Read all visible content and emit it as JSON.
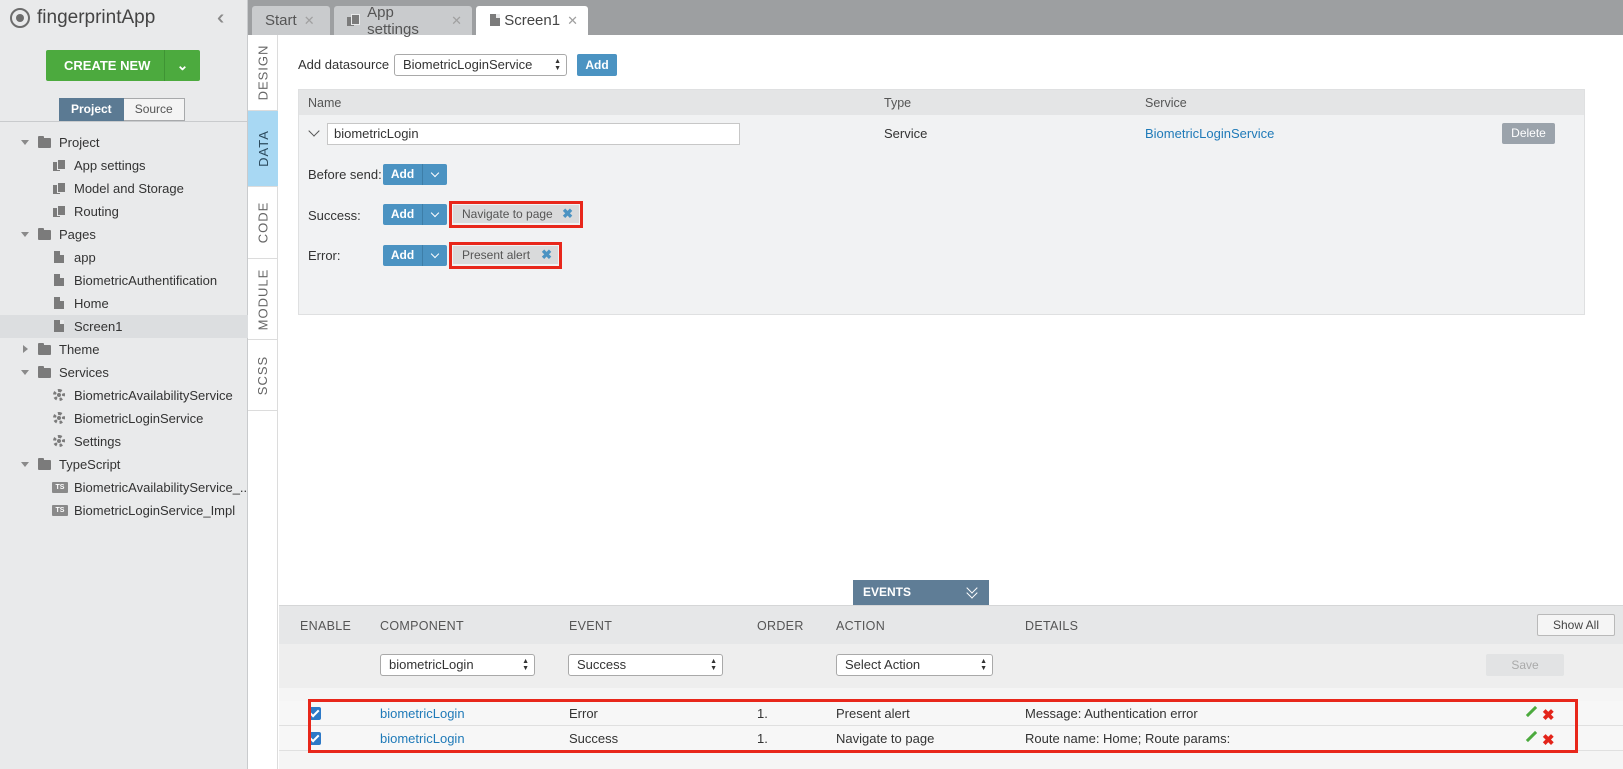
{
  "app": {
    "title": "fingerprintApp"
  },
  "sidebar": {
    "create_new_label": "CREATE NEW",
    "view_tabs": [
      "Project",
      "Source"
    ],
    "tree": [
      {
        "label": "Project",
        "icon": "folder-icon"
      },
      {
        "label": "App settings",
        "icon": "settings-files-icon"
      },
      {
        "label": "Model and Storage",
        "icon": "settings-files-icon"
      },
      {
        "label": "Routing",
        "icon": "settings-files-icon"
      },
      {
        "label": "Pages",
        "icon": "folder-icon"
      },
      {
        "label": "app",
        "icon": "page-icon"
      },
      {
        "label": "BiometricAuthentification",
        "icon": "page-icon"
      },
      {
        "label": "Home",
        "icon": "page-icon"
      },
      {
        "label": "Screen1",
        "icon": "page-icon"
      },
      {
        "label": "Theme",
        "icon": "folder-icon"
      },
      {
        "label": "Services",
        "icon": "folder-icon"
      },
      {
        "label": "BiometricAvailabilityService",
        "icon": "gear-icon"
      },
      {
        "label": "BiometricLoginService",
        "icon": "gear-icon"
      },
      {
        "label": "Settings",
        "icon": "gear-icon"
      },
      {
        "label": "TypeScript",
        "icon": "folder-icon"
      },
      {
        "label": "BiometricAvailabilityService_...",
        "icon": "ts-icon"
      },
      {
        "label": "BiometricLoginService_Impl",
        "icon": "ts-icon"
      }
    ]
  },
  "tabs": [
    {
      "label": "Start"
    },
    {
      "label": "App settings"
    },
    {
      "label": "Screen1"
    }
  ],
  "side_tabs": [
    "DESIGN",
    "DATA",
    "CODE",
    "MODULE",
    "SCSS"
  ],
  "datasource": {
    "add_label": "Add datasource",
    "selected": "BiometricLoginService",
    "add_button": "Add",
    "columns": [
      "Name",
      "Type",
      "Service"
    ],
    "row": {
      "name": "biometricLogin",
      "type": "Service",
      "service": "BiometricLoginService",
      "delete_label": "Delete"
    },
    "before_send_label": "Before send:",
    "success_label": "Success:",
    "error_label": "Error:",
    "action_add_label": "Add",
    "success_chip": "Navigate to page",
    "error_chip": "Present alert",
    "chip_close": "✖"
  },
  "events": {
    "tab_label": "EVENTS",
    "columns": [
      "ENABLE",
      "COMPONENT",
      "EVENT",
      "ORDER",
      "ACTION",
      "DETAILS"
    ],
    "show_all_label": "Show All",
    "filter": {
      "component": "biometricLogin",
      "event": "Success",
      "action": "Select Action",
      "save_label": "Save"
    },
    "rows": [
      {
        "component": "biometricLogin",
        "event": "Error",
        "order": "1.",
        "action": "Present alert",
        "details": "Message: Authentication error"
      },
      {
        "component": "biometricLogin",
        "event": "Success",
        "order": "1.",
        "action": "Navigate to page",
        "details": "Route name: Home; Route params:"
      }
    ]
  },
  "colors": {
    "create_new": "#4caa3e",
    "accent_blue": "#4b93c2",
    "highlight_red": "#e8271b",
    "active_side_tab": "#a8d8f3"
  }
}
